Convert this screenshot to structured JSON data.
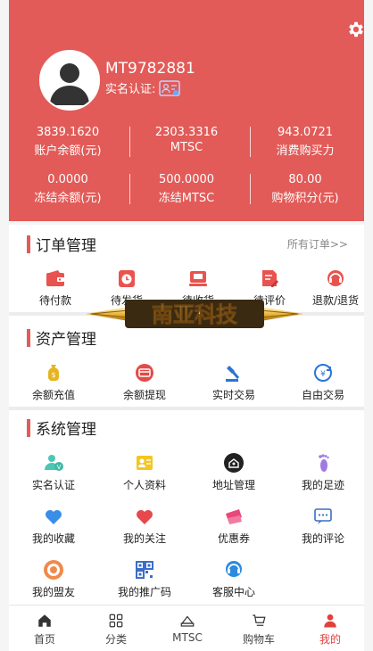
{
  "colors": {
    "brand": "#e25b58",
    "accent": "#e2403d"
  },
  "profile": {
    "username": "MT9782881",
    "realname_label": "实名认证:",
    "icons": {
      "settings": "gear-icon",
      "avatar": "avatar",
      "id_card": "id-card-icon"
    }
  },
  "stats": [
    {
      "value": "3839.1620",
      "label": "账户余额(元)"
    },
    {
      "value": "2303.3316",
      "label": "MTSC"
    },
    {
      "value": "943.0721",
      "label": "消费购买力"
    },
    {
      "value": "0.0000",
      "label": "冻结余额(元)"
    },
    {
      "value": "500.0000",
      "label": "冻结MTSC"
    },
    {
      "value": "80.00",
      "label": "购物积分(元)"
    }
  ],
  "orders": {
    "title": "订单管理",
    "more": "所有订单>>",
    "items": [
      {
        "label": "待付款",
        "icon": "wallet-icon"
      },
      {
        "label": "待发货",
        "icon": "clock-icon"
      },
      {
        "label": "待收货",
        "icon": "truck-icon"
      },
      {
        "label": "待评价",
        "icon": "edit-icon"
      },
      {
        "label": "退款/退货",
        "icon": "headset-icon"
      }
    ]
  },
  "banner": {
    "text": "南亚科技"
  },
  "assets": {
    "title": "资产管理",
    "items": [
      {
        "label": "余额充值",
        "icon": "money-bag-icon"
      },
      {
        "label": "余额提现",
        "icon": "card-icon"
      },
      {
        "label": "实时交易",
        "icon": "hammer-icon"
      },
      {
        "label": "自由交易",
        "icon": "exchange-icon"
      }
    ]
  },
  "system": {
    "title": "系统管理",
    "items": [
      {
        "label": "实名认证",
        "icon": "user-verify-icon"
      },
      {
        "label": "个人资料",
        "icon": "profile-card-icon"
      },
      {
        "label": "地址管理",
        "icon": "location-icon"
      },
      {
        "label": "我的足迹",
        "icon": "footprint-icon"
      },
      {
        "label": "我的收藏",
        "icon": "heart-blue-icon"
      },
      {
        "label": "我的关注",
        "icon": "heart-red-icon"
      },
      {
        "label": "优惠券",
        "icon": "coupon-icon"
      },
      {
        "label": "我的评论",
        "icon": "comment-icon"
      },
      {
        "label": "我的盟友",
        "icon": "ally-icon"
      },
      {
        "label": "我的推广码",
        "icon": "qrcode-icon"
      },
      {
        "label": "客服中心",
        "icon": "service-icon"
      }
    ]
  },
  "tabs": [
    {
      "label": "首页",
      "icon": "home-icon"
    },
    {
      "label": "分类",
      "icon": "grid-icon"
    },
    {
      "label": "MTSC",
      "icon": "coin-icon"
    },
    {
      "label": "购物车",
      "icon": "cart-icon"
    },
    {
      "label": "我的",
      "icon": "person-icon"
    }
  ]
}
